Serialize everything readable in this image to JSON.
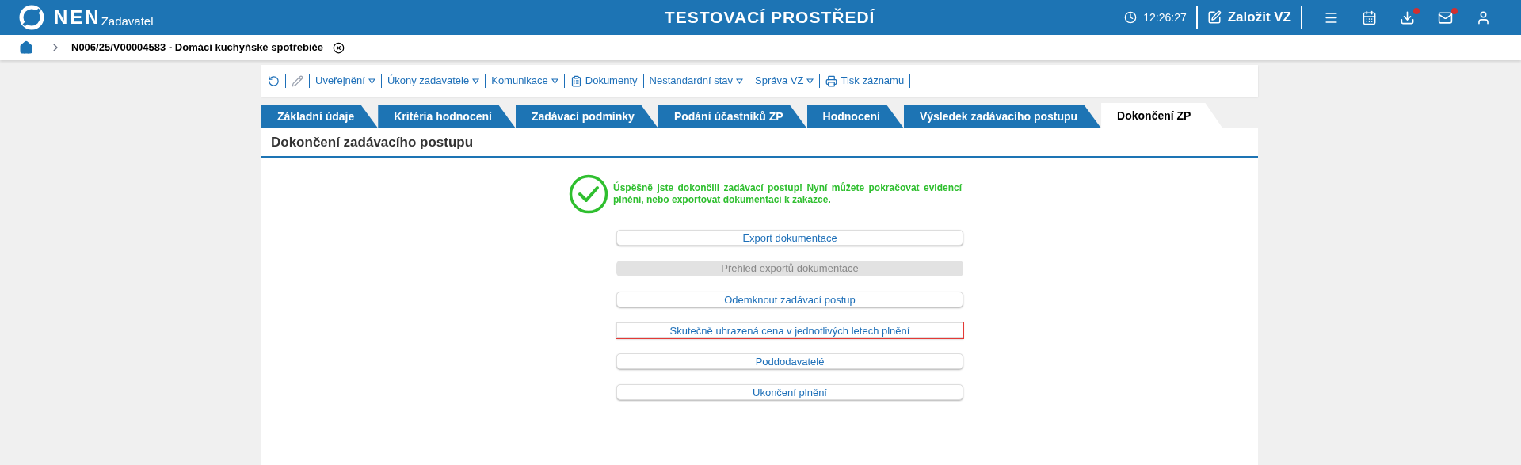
{
  "header": {
    "logo": "NEN",
    "role": "Zadavatel",
    "environment": "TESTOVACÍ PROSTŘEDÍ",
    "time": "12:26:27",
    "create_button": "Založit VZ",
    "icons": [
      {
        "notification": false
      },
      {
        "notification": false
      },
      {
        "notification": true
      },
      {
        "notification": true
      },
      {
        "notification": false
      }
    ]
  },
  "breadcrumb": {
    "title": "N006/25/V00004583 - Domácí kuchyňské spotřebiče"
  },
  "toolbar": [
    {
      "kind": "icon",
      "disabled": false
    },
    {
      "kind": "icon",
      "disabled": true
    },
    {
      "kind": "menu",
      "label": "Uveřejnění"
    },
    {
      "kind": "menu",
      "label": "Úkony zadavatele"
    },
    {
      "kind": "menu",
      "label": "Komunikace"
    },
    {
      "kind": "link",
      "label": "Dokumenty"
    },
    {
      "kind": "menu",
      "label": "Nestandardní stav"
    },
    {
      "kind": "menu",
      "label": "Správa VZ"
    },
    {
      "kind": "link",
      "label": "Tisk záznamu"
    }
  ],
  "tabs": [
    {
      "label": "Základní údaje",
      "selected": false
    },
    {
      "label": "Kritéria hodnocení",
      "selected": false
    },
    {
      "label": "Zadávací podmínky",
      "selected": false
    },
    {
      "label": "Podání účastníků ZP",
      "selected": false
    },
    {
      "label": "Hodnocení",
      "selected": false
    },
    {
      "label": "Výsledek zadávacího postupu",
      "selected": false
    },
    {
      "label": "Dokončení ZP",
      "selected": true
    }
  ],
  "section_title": "Dokončení zadávacího postupu",
  "message": "Úspěšně jste dokončili zadávací postup! Nyní můžete pokračovat evidencí plnění, nebo exportovat dokumentaci k zakázce.",
  "buttons": [
    {
      "label": "Export dokumentace",
      "disabled": false,
      "focused": false
    },
    {
      "label": "Přehled exportů dokumentace",
      "disabled": true,
      "focused": false
    },
    {
      "label": "Odemknout zadávací postup",
      "disabled": false,
      "focused": false
    },
    {
      "label": "Skutečně uhrazená cena v jednotlivých letech plnění",
      "disabled": false,
      "focused": true
    },
    {
      "label": "Poddodavatelé",
      "disabled": false,
      "focused": false
    },
    {
      "label": "Ukončení plnění",
      "disabled": false,
      "focused": false
    }
  ]
}
